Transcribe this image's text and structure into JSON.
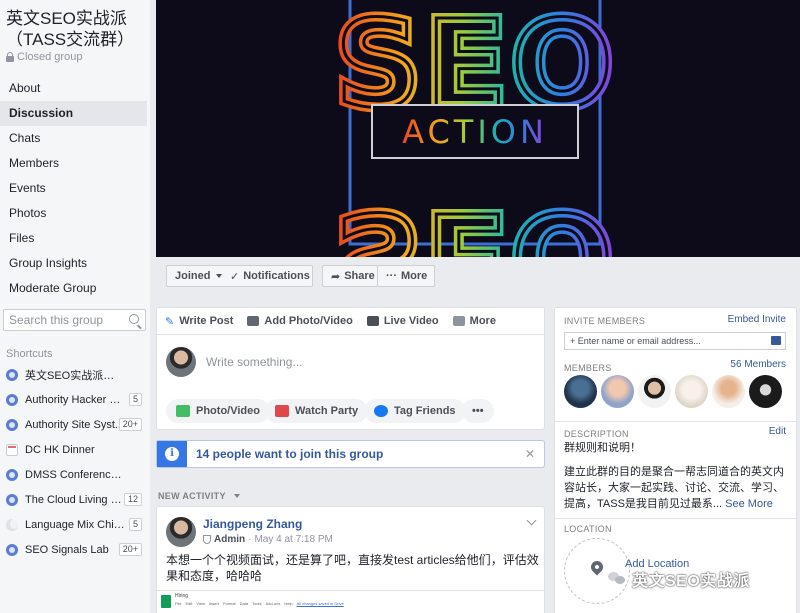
{
  "group": {
    "title": "英文SEO实战派（TASS交流群）",
    "privacy": "Closed group"
  },
  "nav": [
    "About",
    "Discussion",
    "Chats",
    "Members",
    "Events",
    "Photos",
    "Files",
    "Group Insights",
    "Moderate Group"
  ],
  "nav_active": "Discussion",
  "search": {
    "placeholder": "Search this group"
  },
  "shortcuts": {
    "header": "Shortcuts",
    "items": [
      {
        "label": "英文SEO实战派（TASS...",
        "badge": "",
        "icon": "group-icon"
      },
      {
        "label": "Authority Hacker Pro",
        "badge": "5",
        "icon": "group-icon"
      },
      {
        "label": "Authority Site Syst...",
        "badge": "20+",
        "icon": "group-icon"
      },
      {
        "label": "DC HK Dinner",
        "badge": "",
        "icon": "calendar-icon"
      },
      {
        "label": "DMSS Conference Co...",
        "badge": "",
        "icon": "group-icon"
      },
      {
        "label": "The Cloud Living C...",
        "badge": "12",
        "icon": "group-icon"
      },
      {
        "label": "Language Mix China",
        "badge": "5",
        "icon": "moon-icon"
      },
      {
        "label": "SEO Signals Lab",
        "badge": "20+",
        "icon": "group-icon"
      }
    ]
  },
  "cover": {
    "line1": "SEO",
    "word": "ACTION",
    "line2": "SEO"
  },
  "actions": {
    "joined": "Joined",
    "notifications": "Notifications",
    "share": "Share",
    "more": "More"
  },
  "composer": {
    "tabs": [
      "Write Post",
      "Add Photo/Video",
      "Live Video",
      "More"
    ],
    "placeholder": "Write something...",
    "buttons": [
      "Photo/Video",
      "Watch Party",
      "Tag Friends"
    ]
  },
  "join_banner": "14 people want to join this group",
  "new_activity": "NEW ACTIVITY",
  "post": {
    "author": "Jiangpeng Zhang",
    "role": "Admin",
    "time": "May 4 at 7:18 PM",
    "text": "本想一个个视频面试，还是算了吧，直接发test articles给他们，评估效果和态度，哈哈哈",
    "attachment": {
      "title": "Hiring",
      "menu": [
        "File",
        "Edit",
        "View",
        "Insert",
        "Format",
        "Data",
        "Tools",
        "Add-ons",
        "Help"
      ],
      "saved": "All changes saved in Drive"
    }
  },
  "sidebar_right": {
    "invite_header": "INVITE MEMBERS",
    "embed_invite": "Embed Invite",
    "invite_placeholder": "+ Enter name or email address...",
    "members_header": "MEMBERS",
    "members_count": "56 Members",
    "description_header": "DESCRIPTION",
    "edit": "Edit",
    "description_title": "群规则和说明！",
    "description_body": "建立此群的目的是聚合一帮志同道合的英文内容站长，大家一起实践、讨论、交流、学习、提高，TASS是我目前见过最系...",
    "see_more": "See More",
    "location_header": "LOCATION",
    "add_location": "Add Location"
  },
  "watermark": "英文SEO实战派",
  "colors": {
    "link": "#365899",
    "accent": "#3578e5",
    "sidebar_bg": "#f5f6f7",
    "page_bg": "#e9ebee",
    "cover_bg": "#0d0a1a",
    "frame_blue": "#3b6fd4"
  }
}
